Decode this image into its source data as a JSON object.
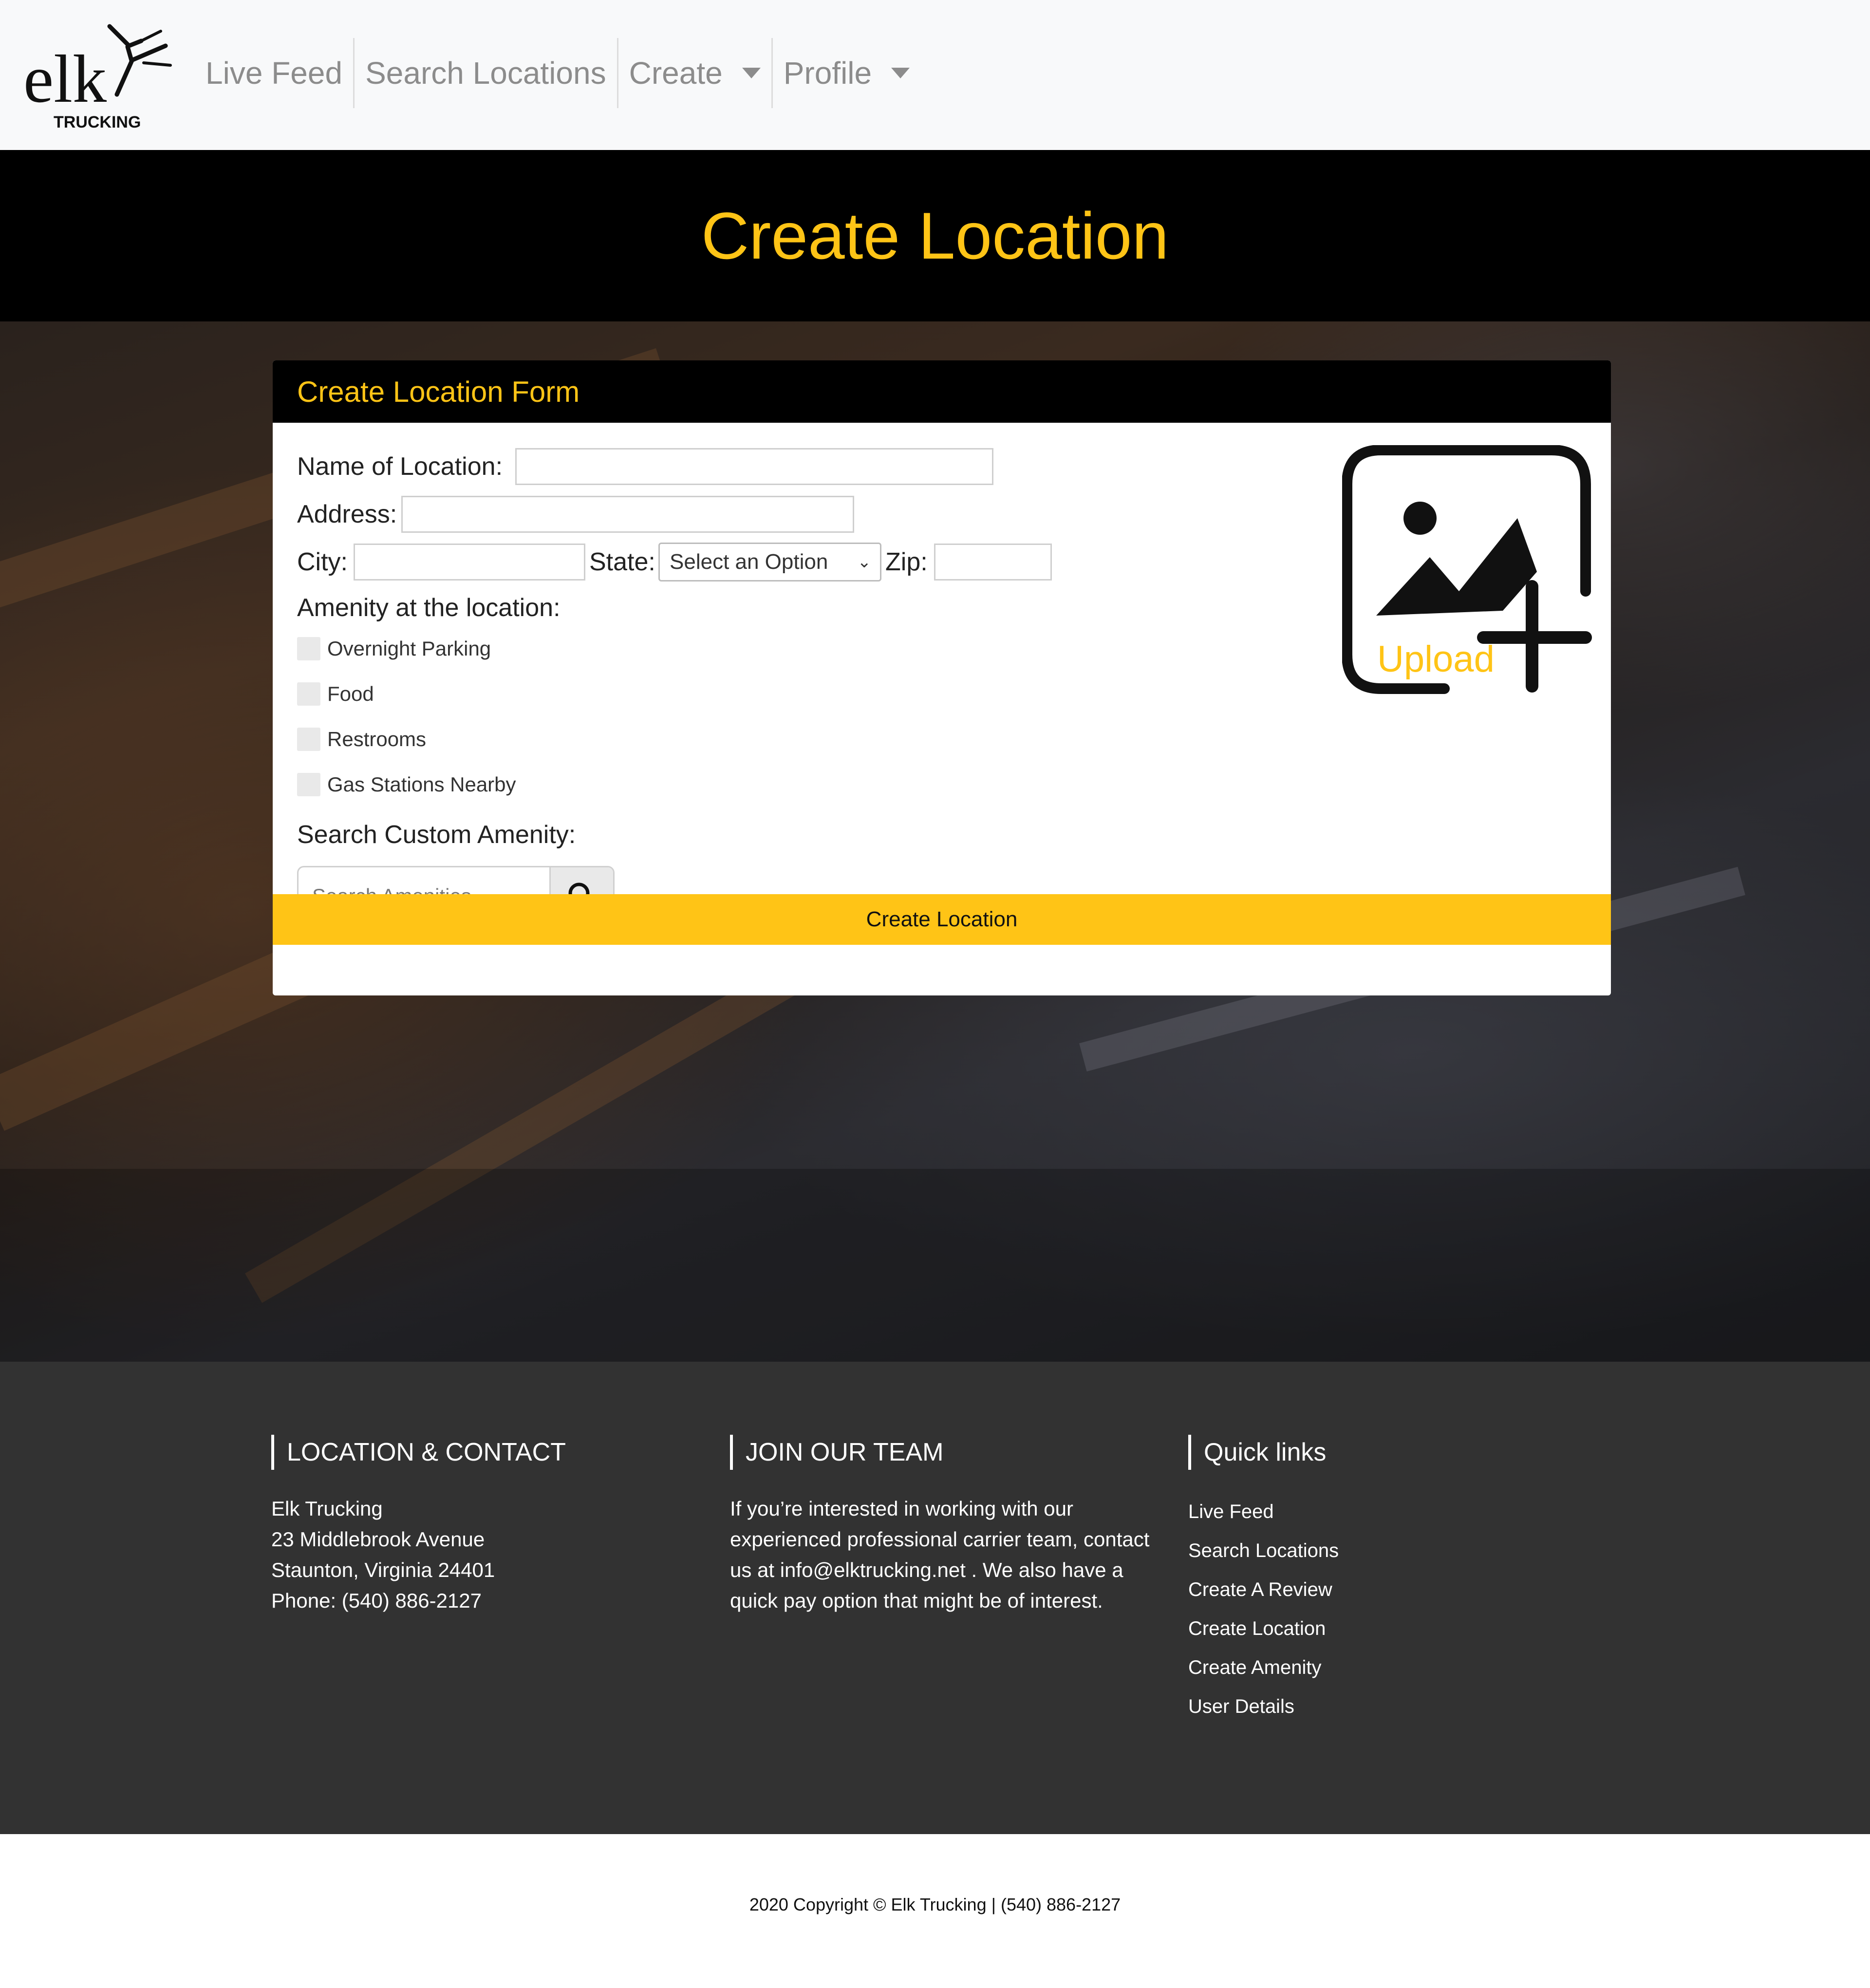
{
  "nav": {
    "logo_text": "elk",
    "logo_sub": "TRUCKING",
    "items": [
      {
        "label": "Live Feed"
      },
      {
        "label": "Search Locations"
      },
      {
        "label": "Create"
      },
      {
        "label": "Profile"
      }
    ]
  },
  "hero": {
    "title": "Create Location"
  },
  "form": {
    "header": "Create Location Form",
    "name_label": "Name of Location:",
    "address_label": "Address:",
    "city_label": "City:",
    "state_label": "State:",
    "state_selected": "Select an Option",
    "zip_label": "Zip:",
    "amenity_label": "Amenity at the location:",
    "amenities": [
      {
        "label": "Overnight Parking",
        "checked": false
      },
      {
        "label": "Food",
        "checked": false
      },
      {
        "label": "Restrooms",
        "checked": false
      },
      {
        "label": "Gas Stations Nearby",
        "checked": false
      }
    ],
    "custom_label": "Search Custom Amenity:",
    "search_placeholder": "Search Amenities",
    "upload_text": "Upload",
    "submit_label": "Create Location"
  },
  "footer": {
    "contact": {
      "heading": "LOCATION & CONTACT",
      "lines": [
        "Elk Trucking",
        "23 Middlebrook Avenue",
        "Staunton, Virginia 24401",
        "Phone: (540) 886-2127"
      ]
    },
    "team": {
      "heading": "JOIN OUR TEAM",
      "text": "If you’re interested in working with our experienced professional carrier team, contact us at info@elktrucking.net . We also have a quick pay option that might be of interest."
    },
    "links": {
      "heading": "Quick links",
      "items": [
        "Live Feed",
        "Search Locations",
        "Create A Review",
        "Create Location",
        "Create Amenity",
        "User Details"
      ]
    }
  },
  "copyright": "2020 Copyright © Elk Trucking | (540) 886-2127",
  "colors": {
    "accent": "#ffc416",
    "footer_bg": "#323232",
    "nav_bg": "#f8f9fa"
  }
}
